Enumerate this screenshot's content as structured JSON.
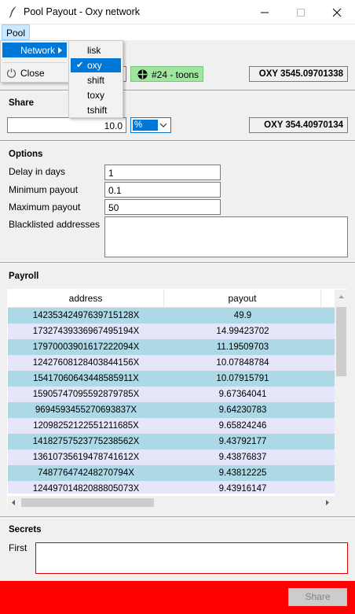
{
  "window": {
    "title": "Pool Payout - Oxy network"
  },
  "menubar": {
    "pool_label": "Pool"
  },
  "pool_menu": {
    "network_label": "Network",
    "close_label": "Close"
  },
  "network_submenu": {
    "items": [
      {
        "label": "lisk",
        "checked": false
      },
      {
        "label": "oxy",
        "checked": true
      },
      {
        "label": "shift",
        "checked": false
      },
      {
        "label": "toxy",
        "checked": false
      },
      {
        "label": "tshift",
        "checked": false
      }
    ],
    "check_glyph": "✔"
  },
  "pool": {
    "delegate_button": "#24 - toons",
    "balance": "OXY 3545.09701338"
  },
  "share": {
    "title": "Share",
    "value": "10.0",
    "unit": "%",
    "amount": "OXY 354.40970134"
  },
  "options": {
    "title": "Options",
    "delay_label": "Delay in days",
    "delay_value": "1",
    "min_label": "Minimum payout",
    "min_value": "0.1",
    "max_label": "Maximum payout",
    "max_value": "50",
    "blacklist_label": "Blacklisted addresses",
    "blacklist_value": ""
  },
  "payroll": {
    "title": "Payroll",
    "columns": [
      "address",
      "payout"
    ],
    "rows": [
      [
        "14235342497639715128X",
        "49.9"
      ],
      [
        "17327439336967495194X",
        "14.99423702"
      ],
      [
        "17970003901617222094X",
        "11.19509703"
      ],
      [
        "12427608128403844156X",
        "10.07848784"
      ],
      [
        "15417060643448585911X",
        "10.07915791"
      ],
      [
        "15905747095592879785X",
        "9.67364041"
      ],
      [
        "9694593455270693837X",
        "9.64230783"
      ],
      [
        "12098252122551211685X",
        "9.65824246"
      ],
      [
        "14182757523775238562X",
        "9.43792177"
      ],
      [
        "13610735619478741612X",
        "9.43876837"
      ],
      [
        "748776474248270794X",
        "9.43812225"
      ],
      [
        "12449701482088805073X",
        "9.43916147"
      ]
    ]
  },
  "secrets": {
    "title": "Secrets",
    "first_label": "First",
    "first_value": ""
  },
  "footer": {
    "share_button": "Share",
    "status_color": "#ff0000"
  },
  "colors": {
    "row_odd": "#add8e6",
    "row_even": "#e6e6fa",
    "pool_button": "#a0e6a0",
    "menu_highlight": "#0078d7"
  }
}
